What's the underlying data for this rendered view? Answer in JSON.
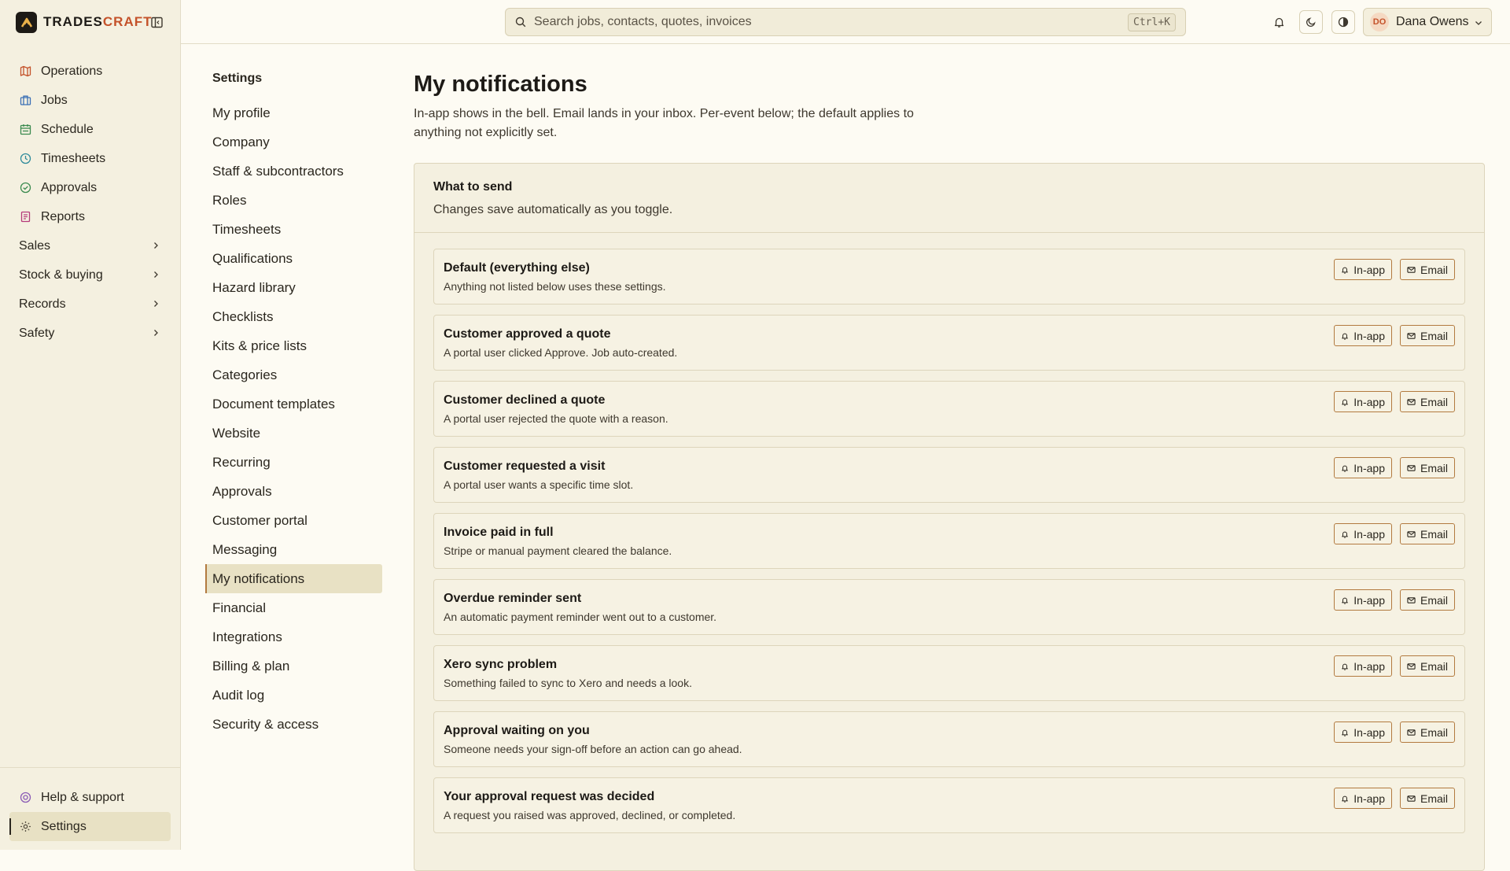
{
  "brand": {
    "name_main": "TRADES",
    "name_accent": "CRAFT"
  },
  "sidebar": {
    "items": [
      {
        "label": "Operations",
        "icon": "map-icon",
        "color": "#c4522a"
      },
      {
        "label": "Jobs",
        "icon": "briefcase-icon",
        "color": "#3a6fb5"
      },
      {
        "label": "Schedule",
        "icon": "calendar-icon",
        "color": "#3a8a4e"
      },
      {
        "label": "Timesheets",
        "icon": "clock-icon",
        "color": "#2d8a9a"
      },
      {
        "label": "Approvals",
        "icon": "check-circle-icon",
        "color": "#3a8a4e"
      },
      {
        "label": "Reports",
        "icon": "report-icon",
        "color": "#b53a7a"
      }
    ],
    "groups": [
      {
        "label": "Sales"
      },
      {
        "label": "Stock & buying"
      },
      {
        "label": "Records"
      },
      {
        "label": "Safety"
      }
    ],
    "bottom": [
      {
        "label": "Help & support",
        "icon": "help-icon",
        "color": "#8a5ab5"
      },
      {
        "label": "Settings",
        "icon": "gear-icon",
        "color": "#5a5346"
      }
    ]
  },
  "topbar": {
    "search_placeholder": "Search jobs, contacts, quotes, invoices",
    "search_shortcut": "Ctrl+K",
    "user": {
      "initials": "DO",
      "name": "Dana Owens"
    }
  },
  "settings_nav": {
    "title": "Settings",
    "items": [
      "My profile",
      "Company",
      "Staff & subcontractors",
      "Roles",
      "Timesheets",
      "Qualifications",
      "Hazard library",
      "Checklists",
      "Kits & price lists",
      "Categories",
      "Document templates",
      "Website",
      "Recurring",
      "Approvals",
      "Customer portal",
      "Messaging",
      "My notifications",
      "Financial",
      "Integrations",
      "Billing & plan",
      "Audit log",
      "Security & access"
    ],
    "active": "My notifications"
  },
  "page": {
    "title": "My notifications",
    "description": "In-app shows in the bell. Email lands in your inbox. Per-event below; the default applies to anything not explicitly set."
  },
  "card": {
    "title": "What to send",
    "subtitle": "Changes save automatically as you toggle.",
    "inapp_label": "In-app",
    "email_label": "Email",
    "events": [
      {
        "title": "Default (everything else)",
        "desc": "Anything not listed below uses these settings."
      },
      {
        "title": "Customer approved a quote",
        "desc": "A portal user clicked Approve. Job auto-created."
      },
      {
        "title": "Customer declined a quote",
        "desc": "A portal user rejected the quote with a reason."
      },
      {
        "title": "Customer requested a visit",
        "desc": "A portal user wants a specific time slot."
      },
      {
        "title": "Invoice paid in full",
        "desc": "Stripe or manual payment cleared the balance."
      },
      {
        "title": "Overdue reminder sent",
        "desc": "An automatic payment reminder went out to a customer."
      },
      {
        "title": "Xero sync problem",
        "desc": "Something failed to sync to Xero and needs a look."
      },
      {
        "title": "Approval waiting on you",
        "desc": "Someone needs your sign-off before an action can go ahead."
      },
      {
        "title": "Your approval request was decided",
        "desc": "A request you raised was approved, declined, or completed."
      }
    ]
  }
}
